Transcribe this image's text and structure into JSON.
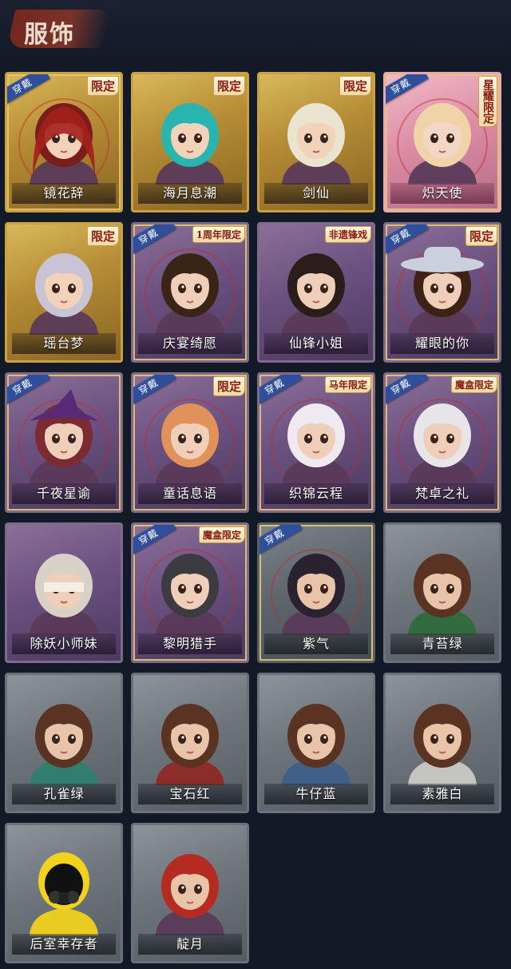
{
  "header": {
    "title": "服饰"
  },
  "worn_label": "穿戴",
  "colors": {
    "background": "#121a28",
    "gold": "#c9a142",
    "purple": "#6c5180",
    "pink": "#d98aa3",
    "gray": "#6e757c",
    "worn_tag": "#2e4f9b",
    "badge_text": "#8a1b12"
  },
  "outfits": [
    {
      "name": "镜花辞",
      "frame": "gold",
      "worn": true,
      "badge": "限定",
      "art": "red-hooded-girl"
    },
    {
      "name": "海月息潮",
      "frame": "gold",
      "worn": false,
      "badge": "限定",
      "art": "teal-hair-girl"
    },
    {
      "name": "剑仙",
      "frame": "gold",
      "worn": false,
      "badge": "限定",
      "art": "white-hair-swordsman"
    },
    {
      "name": "炽天使",
      "frame": "pink",
      "worn": true,
      "badge": "星耀限定",
      "art": "winged-angel"
    },
    {
      "name": "瑶台梦",
      "frame": "gold",
      "worn": false,
      "badge": "限定",
      "art": "silver-hair-girl"
    },
    {
      "name": "庆宴绮愿",
      "frame": "purple",
      "worn": true,
      "badge": "1周年限定",
      "art": "cake-girl"
    },
    {
      "name": "仙锋小姐",
      "frame": "purple",
      "worn": false,
      "badge": "非遗锋戏",
      "art": "masked-girl"
    },
    {
      "name": "耀眼的你",
      "frame": "purple",
      "worn": true,
      "badge": "限定",
      "art": "cowgirl"
    },
    {
      "name": "千夜星谕",
      "frame": "purple",
      "worn": true,
      "badge": "",
      "art": "witch-hat-girl"
    },
    {
      "name": "童话息语",
      "frame": "purple",
      "worn": true,
      "badge": "限定",
      "art": "fairy-tale-girl"
    },
    {
      "name": "织锦云程",
      "frame": "purple",
      "worn": true,
      "badge": "马年限定",
      "art": "bunny-ear-girl"
    },
    {
      "name": "梵卓之礼",
      "frame": "purple",
      "worn": true,
      "badge": "魔盒限定",
      "art": "vampire-girl"
    },
    {
      "name": "除妖小师妹",
      "frame": "purple",
      "worn": false,
      "badge": "",
      "art": "blindfold-girl"
    },
    {
      "name": "黎明猎手",
      "frame": "purple",
      "worn": true,
      "badge": "魔盒限定",
      "art": "hunter-boy"
    },
    {
      "name": "紫气",
      "frame": "gray-dark",
      "worn": true,
      "badge": "",
      "art": "braid-boy"
    },
    {
      "name": "青苔绿",
      "frame": "gray",
      "worn": false,
      "badge": "",
      "art": "survivor-girl-green"
    },
    {
      "name": "孔雀绿",
      "frame": "gray",
      "worn": false,
      "badge": "",
      "art": "survivor-girl-teal"
    },
    {
      "name": "宝石红",
      "frame": "gray",
      "worn": false,
      "badge": "",
      "art": "survivor-girl-red"
    },
    {
      "name": "牛仔蓝",
      "frame": "gray",
      "worn": false,
      "badge": "",
      "art": "survivor-girl-blue"
    },
    {
      "name": "素雅白",
      "frame": "gray",
      "worn": false,
      "badge": "",
      "art": "survivor-girl-white"
    },
    {
      "name": "后室幸存者",
      "frame": "gray",
      "worn": false,
      "badge": "",
      "art": "hazmat-survivor"
    },
    {
      "name": "靛月",
      "frame": "gray",
      "worn": false,
      "badge": "",
      "art": "red-hair-girl"
    }
  ]
}
